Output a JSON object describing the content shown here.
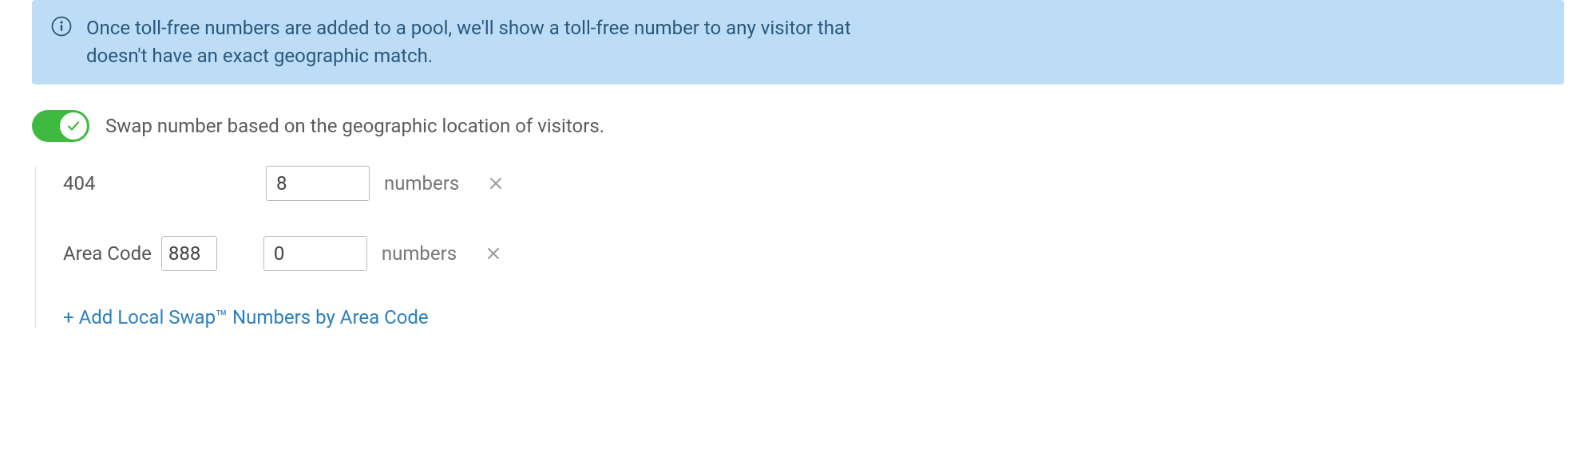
{
  "info": {
    "text": "Once toll-free numbers are added to a pool, we'll show a toll-free number to any visitor that doesn't have an exact geographic match."
  },
  "toggle": {
    "label": "Swap number based on the geographic location of visitors.",
    "checked": true
  },
  "rows": [
    {
      "area_code_label": "404",
      "area_code_editable": false,
      "count": "8",
      "suffix": "numbers"
    },
    {
      "prefix_label": "Area Code",
      "area_code_value": "888",
      "area_code_editable": true,
      "count": "0",
      "suffix": "numbers"
    }
  ],
  "add_link": "+ Add Local Swap™ Numbers by Area Code",
  "colors": {
    "info_bg": "#bdddf6",
    "info_text": "#2a577d",
    "toggle_on": "#3fb93f",
    "link": "#2a7fc1"
  }
}
